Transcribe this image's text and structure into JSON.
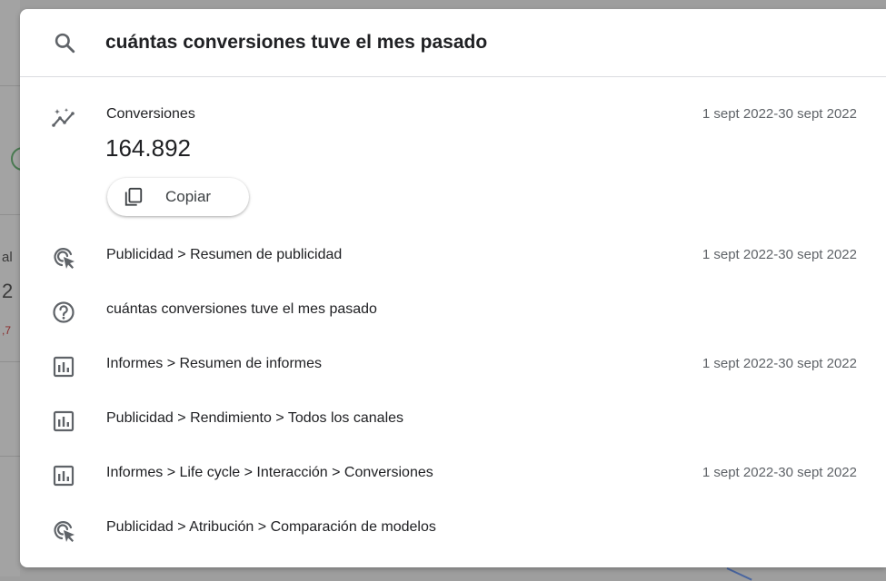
{
  "search": {
    "query": "cuántas conversiones tuve el mes pasado",
    "icon": "search-icon"
  },
  "metric": {
    "icon": "insights-icon",
    "label": "Conversiones",
    "value": "164.892",
    "date_range": "1 sept 2022-30 sept 2022",
    "copy_label": "Copiar",
    "copy_icon": "copy-icon"
  },
  "results": [
    {
      "icon": "ads-click-icon",
      "text": "Publicidad > Resumen de publicidad",
      "date_range": "1 sept 2022-30 sept 2022"
    },
    {
      "icon": "help-icon",
      "text": "cuántas conversiones tuve el mes pasado",
      "date_range": ""
    },
    {
      "icon": "bar-chart-icon",
      "text": "Informes > Resumen de informes",
      "date_range": "1 sept 2022-30 sept 2022"
    },
    {
      "icon": "bar-chart-icon",
      "text": "Publicidad > Rendimiento > Todos los canales",
      "date_range": ""
    },
    {
      "icon": "bar-chart-icon",
      "text": "Informes > Life cycle > Interacción > Conversiones",
      "date_range": "1 sept 2022-30 sept 2022"
    },
    {
      "icon": "ads-click-icon",
      "text": "Publicidad > Atribución > Comparación de modelos",
      "date_range": ""
    }
  ],
  "background": {
    "fragments": [
      "al",
      "2",
      ",7"
    ]
  },
  "colors": {
    "text": "#202124",
    "secondary": "#5f6368",
    "icon": "#5f6368",
    "divider": "#dadce0"
  }
}
